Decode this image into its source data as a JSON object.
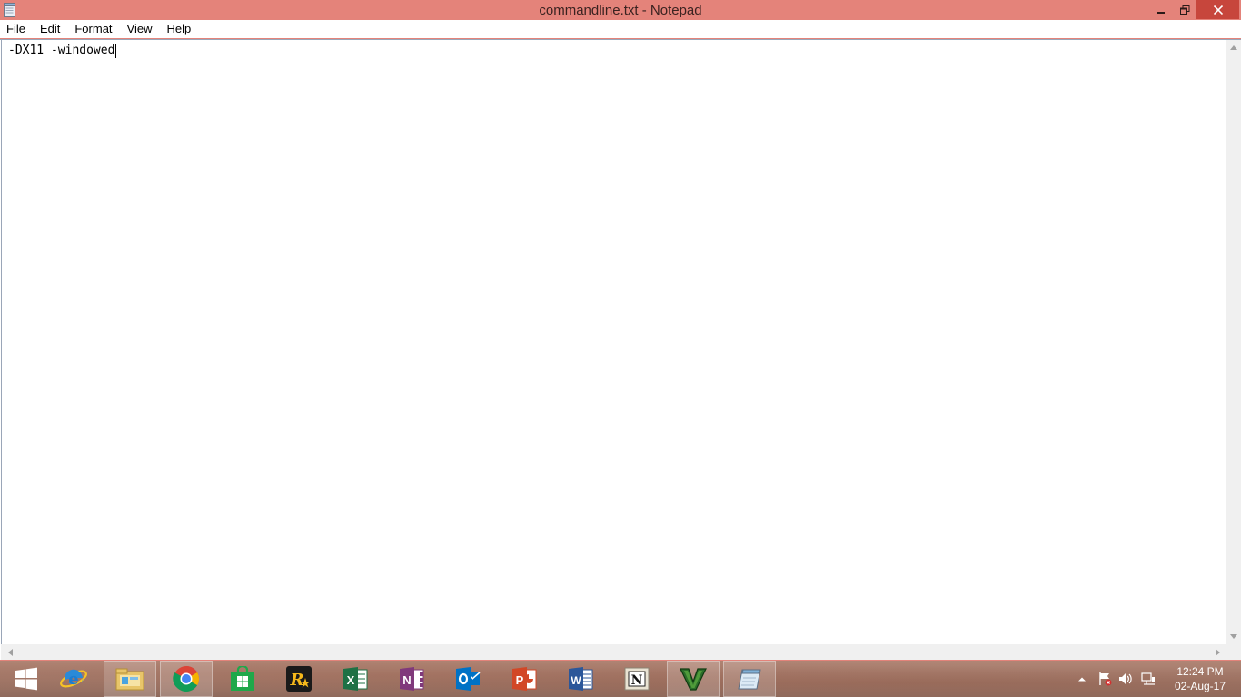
{
  "window": {
    "title": "commandline.txt - Notepad"
  },
  "menu": {
    "items": [
      "File",
      "Edit",
      "Format",
      "View",
      "Help"
    ]
  },
  "editor": {
    "content": "-DX11 -windowed"
  },
  "taskbar": {
    "apps": [
      {
        "name": "start-button",
        "icon": "windows-logo-icon"
      },
      {
        "name": "internet-explorer",
        "icon": "internet-explorer-icon"
      },
      {
        "name": "file-explorer",
        "icon": "folder-icon"
      },
      {
        "name": "google-chrome",
        "icon": "chrome-icon"
      },
      {
        "name": "store",
        "icon": "store-icon"
      },
      {
        "name": "rockstar-launcher",
        "icon": "rockstar-icon"
      },
      {
        "name": "excel",
        "icon": "excel-icon"
      },
      {
        "name": "onenote",
        "icon": "onenote-icon"
      },
      {
        "name": "outlook",
        "icon": "outlook-icon"
      },
      {
        "name": "powerpoint",
        "icon": "powerpoint-icon"
      },
      {
        "name": "word",
        "icon": "word-icon"
      },
      {
        "name": "nitro-app",
        "icon": "nitro-icon"
      },
      {
        "name": "gta-v",
        "icon": "gta-v-icon"
      },
      {
        "name": "notepad",
        "icon": "notepad-icon"
      }
    ],
    "clock": {
      "time": "12:24 PM",
      "date": "02-Aug-17"
    }
  },
  "colors": {
    "accent": "#e4837a",
    "close_button": "#c7463c"
  }
}
